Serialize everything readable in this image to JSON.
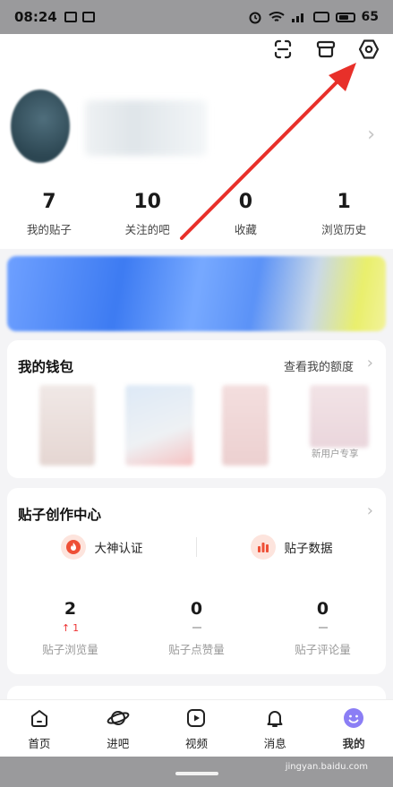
{
  "status_bar": {
    "time": "08:24",
    "battery": "65"
  },
  "header": {
    "icons": [
      "scan-icon",
      "box-icon",
      "settings-hexagon-icon"
    ]
  },
  "stats": [
    {
      "value": "7",
      "label": "我的贴子"
    },
    {
      "value": "10",
      "label": "关注的吧"
    },
    {
      "value": "0",
      "label": "收藏"
    },
    {
      "value": "1",
      "label": "浏览历史"
    }
  ],
  "wallet": {
    "title": "我的钱包",
    "link": "查看我的额度",
    "new_user_label": "新用户专享"
  },
  "creator": {
    "title": "贴子创作中心",
    "items": [
      {
        "label": "大神认证",
        "icon": "fire-badge-icon"
      },
      {
        "label": "贴子数据",
        "icon": "chart-badge-icon"
      }
    ],
    "metrics": [
      {
        "value": "2",
        "delta": "1",
        "label": "贴子浏览量"
      },
      {
        "value": "0",
        "label": "贴子点赞量"
      },
      {
        "value": "0",
        "label": "贴子评论量"
      }
    ]
  },
  "tabs": [
    {
      "label": "首页",
      "icon": "home-icon"
    },
    {
      "label": "进吧",
      "icon": "planet-icon"
    },
    {
      "label": "视频",
      "icon": "video-icon"
    },
    {
      "label": "消息",
      "icon": "bell-icon"
    },
    {
      "label": "我的",
      "icon": "smile-icon",
      "active": true
    }
  ],
  "watermark": "jingyan.baidu.com",
  "colors": {
    "accent_red": "#e8302a",
    "active_purple": "#7a6cf0",
    "badge_bg": "#fde4dd"
  }
}
